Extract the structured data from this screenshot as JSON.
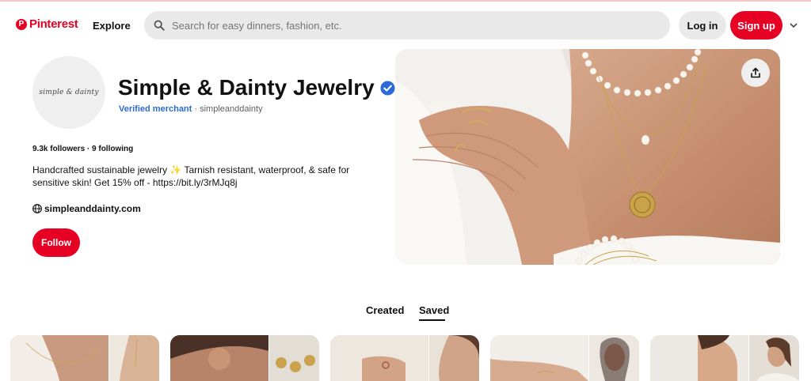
{
  "header": {
    "brand": "Pinterest",
    "explore_label": "Explore",
    "search_placeholder": "Search for easy dinners, fashion, etc.",
    "login_label": "Log in",
    "signup_label": "Sign up"
  },
  "profile": {
    "avatar_text": "simple & dainty",
    "name": "Simple & Dainty Jewelry",
    "merchant_badge": "Verified merchant",
    "username": "· simpleanddainty",
    "follow_stats": "9.3k followers · 9 following",
    "bio": "Handcrafted sustainable jewelry ✨ Tarnish resistant, waterproof, & safe for sensitive skin! Get 15% off - https://bit.ly/3rMJq8j",
    "website": "simpleanddainty.com",
    "follow_label": "Follow"
  },
  "tabs": [
    {
      "label": "Created",
      "active": false
    },
    {
      "label": "Saved",
      "active": true
    }
  ],
  "colors": {
    "brand_red": "#e60023",
    "verified_blue": "#2b6ad8",
    "search_bg": "#e9e9e9"
  },
  "icons": {
    "logo": "pinterest-p-icon",
    "search": "search-icon",
    "menu": "chevron-down-icon",
    "verified": "verified-check-icon",
    "website": "globe-icon",
    "share": "share-upload-icon"
  }
}
